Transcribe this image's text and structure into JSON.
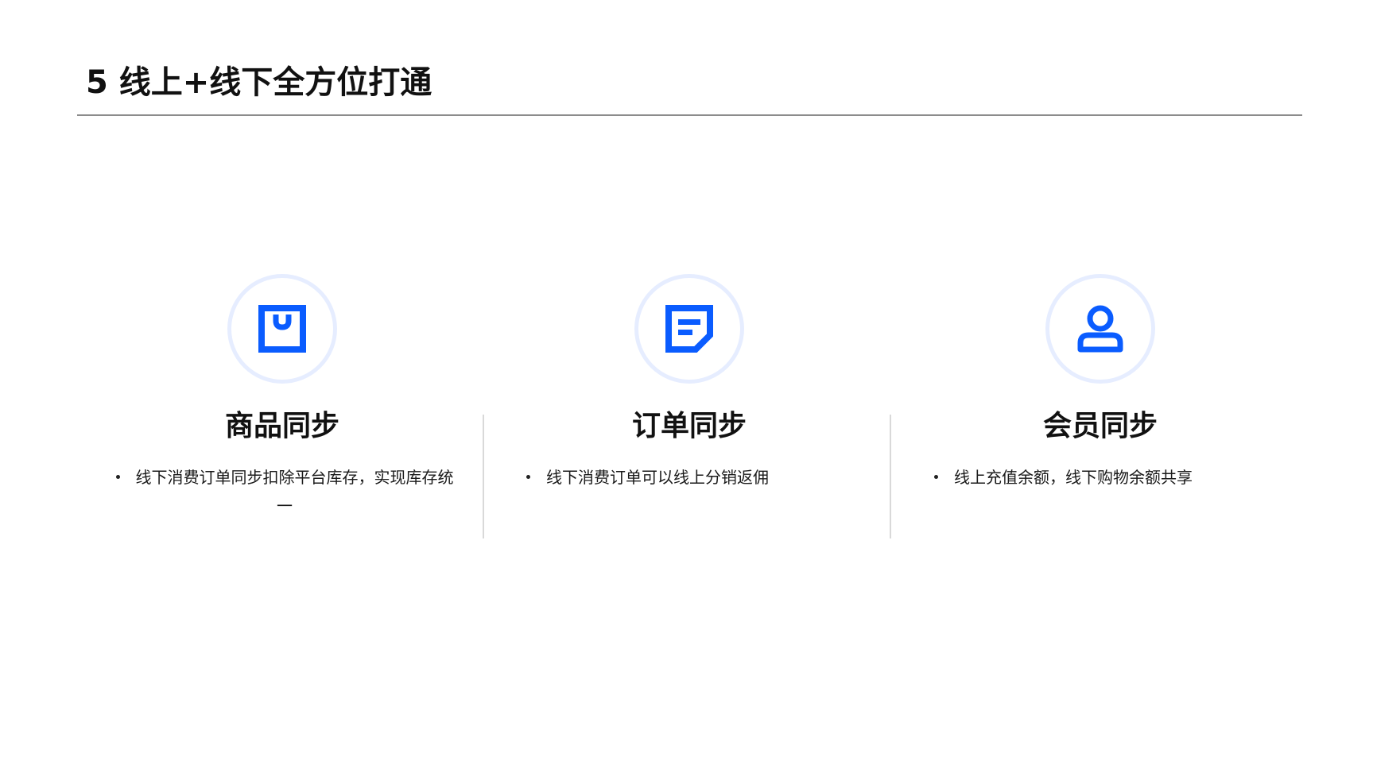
{
  "page": {
    "title": "5 线上+线下全方位打通"
  },
  "colors": {
    "accent": "#0a5cff",
    "icon_ring": "#e6edff",
    "rule": "#8c8c8c",
    "divider": "#d9d9d9"
  },
  "features": [
    {
      "icon": "shopping-bag-icon",
      "title": "商品同步",
      "bullets": [
        "线下消费订单同步扣除平台库存，实现库存统一"
      ]
    },
    {
      "icon": "document-icon",
      "title": "订单同步",
      "bullets": [
        "线下消费订单可以线上分销返佣"
      ]
    },
    {
      "icon": "user-icon",
      "title": "会员同步",
      "bullets": [
        "线上充值余额，线下购物余额共享"
      ]
    }
  ]
}
